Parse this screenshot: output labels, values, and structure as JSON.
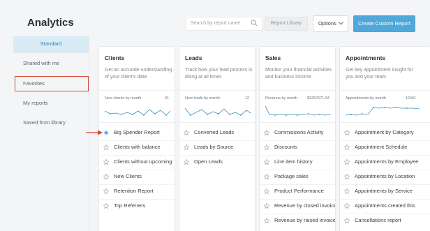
{
  "header": {
    "title": "Analytics",
    "search_placeholder": "Search by report name",
    "library_label": "Report Library",
    "options_label": "Options",
    "create_label": "Create Custom Report"
  },
  "sidebar": {
    "items": [
      {
        "label": "Standard",
        "active": true
      },
      {
        "label": "Shared with me"
      },
      {
        "label": "Favorites"
      },
      {
        "label": "My reports"
      },
      {
        "label": "Saved from library"
      }
    ]
  },
  "cards": [
    {
      "title": "Clients",
      "description": "Get an accurate understanding of your client's data",
      "metric_label": "New clients by month",
      "metric_value": "41",
      "reports": [
        {
          "label": "Big Spender Report",
          "favorite": true
        },
        {
          "label": "Clients with balance"
        },
        {
          "label": "Clients without upcoming"
        },
        {
          "label": "New Clients"
        },
        {
          "label": "Retention Report"
        },
        {
          "label": "Top Referrers"
        }
      ]
    },
    {
      "title": "Leads",
      "description": "Track how your lead process is doing at all times",
      "metric_label": "New leads by month",
      "metric_value": "12",
      "reports": [
        {
          "label": "Converted Leads"
        },
        {
          "label": "Leads by Source"
        },
        {
          "label": "Open Leads"
        }
      ]
    },
    {
      "title": "Sales",
      "description": "Monitor your financial activities and business income",
      "metric_label": "Revenue by month",
      "metric_value": "$1257671.94",
      "reports": [
        {
          "label": "Commissions Activity"
        },
        {
          "label": "Discounts"
        },
        {
          "label": "Line item history"
        },
        {
          "label": "Package sales"
        },
        {
          "label": "Product Performance"
        },
        {
          "label": "Revenue by closed invoice"
        },
        {
          "label": "Revenue by raised invoice"
        }
      ]
    },
    {
      "title": "Appointments",
      "description": "Get key appointment insight for you and your team",
      "metric_label": "Appointments by month",
      "metric_value": "12441",
      "reports": [
        {
          "label": "Appointment by Category"
        },
        {
          "label": "Appointment Schedule"
        },
        {
          "label": "Appointments by Employee"
        },
        {
          "label": "Appointments by Location"
        },
        {
          "label": "Appointments by Service"
        },
        {
          "label": "Appointments created this"
        },
        {
          "label": "Cancellations report"
        }
      ]
    }
  ],
  "colors": {
    "accent": "#4fa8d9",
    "highlight_box": "#d4453a",
    "active_sidebar_bg": "#d9ecf6",
    "sparkline": "#3a8fbf"
  }
}
